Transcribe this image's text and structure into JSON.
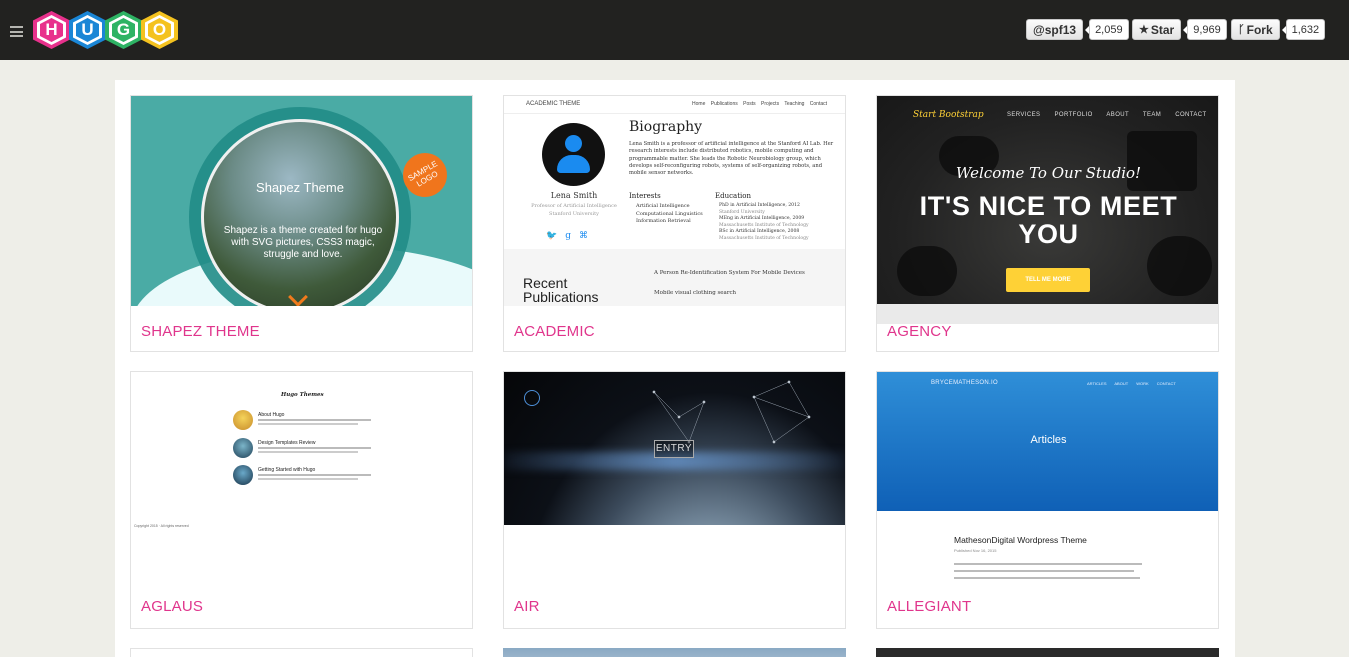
{
  "header": {
    "menu_icon": "hamburger-icon",
    "logo_letters": [
      {
        "letter": "H",
        "color": "#e8318c",
        "ring": "#e8318c"
      },
      {
        "letter": "U",
        "color": "#1a86d6",
        "ring": "#1a86d6"
      },
      {
        "letter": "G",
        "color": "#2eb364",
        "ring": "#2eb364"
      },
      {
        "letter": "O",
        "color": "#f4c21f",
        "ring": "#f4c21f"
      }
    ],
    "follow": {
      "label": "@spf13",
      "count": "2,059"
    },
    "star": {
      "icon": "star-icon",
      "label": "Star",
      "count": "9,969"
    },
    "fork": {
      "icon": "fork-icon",
      "label": "Fork",
      "count": "1,632"
    }
  },
  "themes": [
    {
      "title": "SHAPEZ THEME",
      "preview": {
        "heading": "Shapez Theme",
        "text": "Shapez is a theme created for hugo with SVG pictures, CSS3 magic, struggle and love.",
        "badge": "SAMPLE LOGO"
      }
    },
    {
      "title": "ACADEMIC",
      "preview": {
        "brand": "ACADEMIC THEME",
        "nav": "Home Publications Posts Projects Teaching Contact",
        "heading": "Biography",
        "name": "Lena Smith",
        "role": "Professor of Artificial Intelligence",
        "org": "Stanford University",
        "bio": "Lena Smith is a professor of artificial intelligence at the Stanford AI Lab. Her research interests include distributed robotics, mobile computing and programmable matter. She leads the Robotic Neurobiology group, which develops self-reconfiguring robots, systems of self-organizing robots, and mobile sensor networks.",
        "interests_heading": "Interests",
        "interests": [
          "Artificial Intelligence",
          "Computational Linguistics",
          "Information Retrieval"
        ],
        "education_heading": "Education",
        "education": [
          "PhD in Artificial Intelligence, 2012",
          "Stanford University",
          "MEng in Artificial Intelligence, 2009",
          "Massachusetts Institute of Technology",
          "BSc in Artificial Intelligence, 2008",
          "Massachusetts Institute of Technology"
        ],
        "recent": "Recent Publications",
        "pubs": [
          "A Person Re-Identification System For Mobile Devices",
          "Mobile visual clothing search"
        ]
      }
    },
    {
      "title": "AGENCY",
      "preview": {
        "brand": "Start Bootstrap",
        "nav": "SERVICES PORTFOLIO ABOUT TEAM CONTACT",
        "welcome": "Welcome To Our Studio!",
        "headline": "IT'S NICE TO MEET YOU",
        "cta": "TELL ME MORE"
      }
    },
    {
      "title": "AGLAUS",
      "preview": {
        "heading": "Hugo Themes",
        "posts": [
          "About Hugo",
          "Design Templates Review",
          "Getting Started with Hugo"
        ],
        "footer": "Copyright 2015 · All rights reserved"
      }
    },
    {
      "title": "AIR",
      "preview": {
        "label": "ENTRY"
      }
    },
    {
      "title": "ALLEGIANT",
      "preview": {
        "brand": "BRYCEMATHESON.IO",
        "nav": "ARTICLES ABOUT WORK CONTACT",
        "hero_title": "Articles",
        "post_title": "MathesonDigital Wordpress Theme",
        "post_date": "Published Nov 16, 2015"
      }
    }
  ]
}
